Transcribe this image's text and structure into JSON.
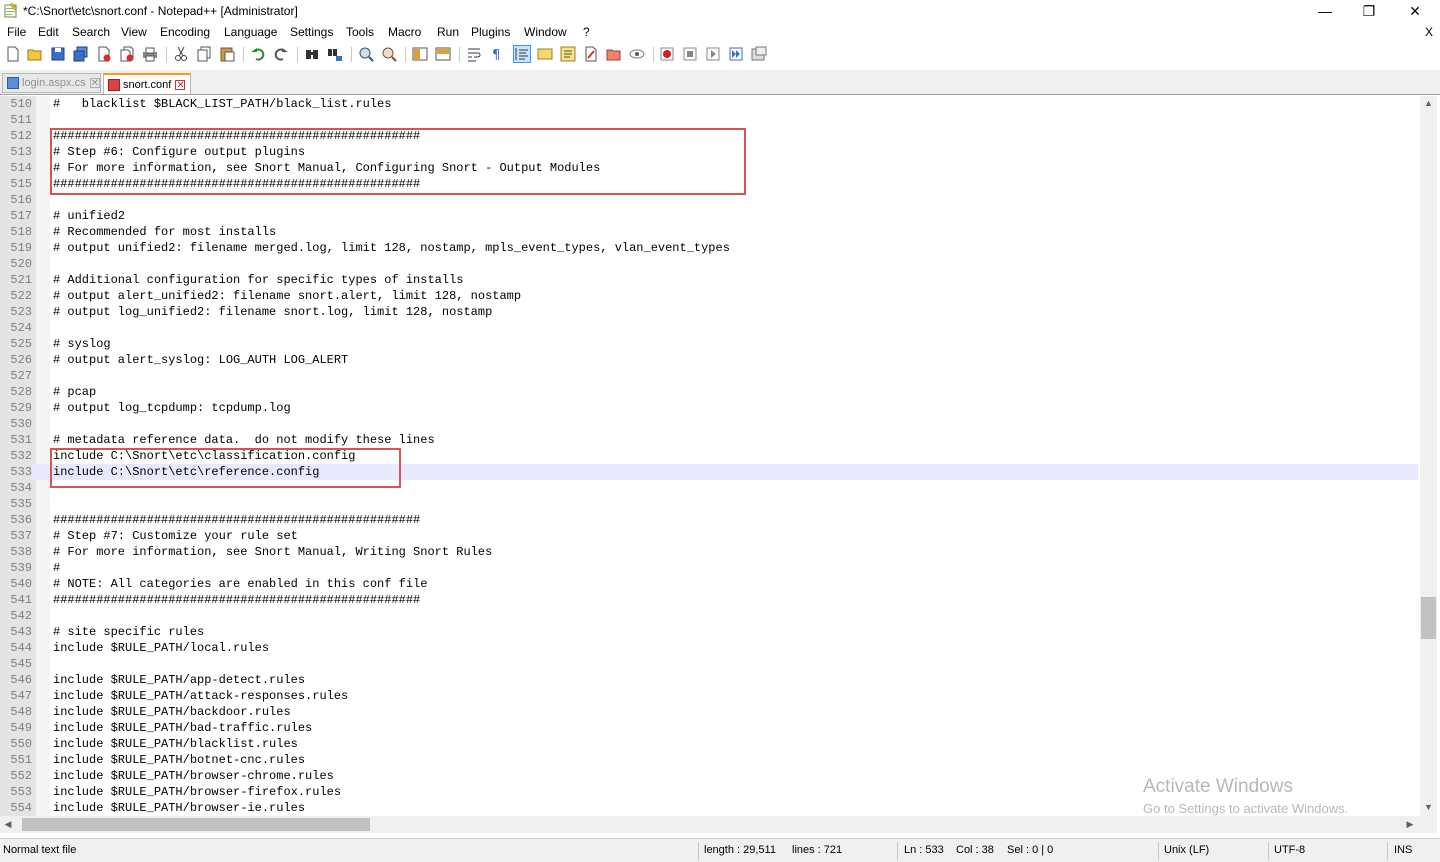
{
  "window": {
    "title": "*C:\\Snort\\etc\\snort.conf - Notepad++ [Administrator]",
    "minimize": "—",
    "restore": "❐",
    "close": "✕"
  },
  "menu": {
    "items": [
      "File",
      "Edit",
      "Search",
      "View",
      "Encoding",
      "Language",
      "Settings",
      "Tools",
      "Macro",
      "Run",
      "Plugins",
      "Window",
      "?"
    ],
    "close": "X"
  },
  "toolbar": {
    "icons": [
      "new-file-icon",
      "open-file-icon",
      "save-icon",
      "save-all-icon",
      "close-icon",
      "close-all-icon",
      "print-icon",
      "cut-icon",
      "copy-icon",
      "paste-icon",
      "undo-icon",
      "redo-icon",
      "find-icon",
      "replace-icon",
      "zoom-in-icon",
      "zoom-out-icon",
      "sync-vertical-icon",
      "sync-horizontal-icon",
      "word-wrap-icon",
      "show-all-chars-icon",
      "indent-guide-icon",
      "lang-icon",
      "function-list-icon",
      "document-map-icon",
      "folder-as-workspace-icon",
      "monitoring-icon",
      "record-macro-icon",
      "stop-record-icon",
      "play-macro-icon",
      "run-macro-multiple-icon",
      "save-macro-icon"
    ]
  },
  "tabs": [
    {
      "label": "login.aspx.cs",
      "close": "✕"
    },
    {
      "label": "snort.conf",
      "close": "✕"
    }
  ],
  "editor": {
    "current_line": 533,
    "lines": [
      {
        "n": "510",
        "t": "#   blacklist $BLACK_LIST_PATH/black_list.rules"
      },
      {
        "n": "511",
        "t": ""
      },
      {
        "n": "512",
        "t": "###################################################"
      },
      {
        "n": "513",
        "t": "# Step #6: Configure output plugins"
      },
      {
        "n": "514",
        "t": "# For more information, see Snort Manual, Configuring Snort - Output Modules"
      },
      {
        "n": "515",
        "t": "###################################################"
      },
      {
        "n": "516",
        "t": ""
      },
      {
        "n": "517",
        "t": "# unified2"
      },
      {
        "n": "518",
        "t": "# Recommended for most installs"
      },
      {
        "n": "519",
        "t": "# output unified2: filename merged.log, limit 128, nostamp, mpls_event_types, vlan_event_types"
      },
      {
        "n": "520",
        "t": ""
      },
      {
        "n": "521",
        "t": "# Additional configuration for specific types of installs"
      },
      {
        "n": "522",
        "t": "# output alert_unified2: filename snort.alert, limit 128, nostamp"
      },
      {
        "n": "523",
        "t": "# output log_unified2: filename snort.log, limit 128, nostamp"
      },
      {
        "n": "524",
        "t": ""
      },
      {
        "n": "525",
        "t": "# syslog"
      },
      {
        "n": "526",
        "t": "# output alert_syslog: LOG_AUTH LOG_ALERT"
      },
      {
        "n": "527",
        "t": ""
      },
      {
        "n": "528",
        "t": "# pcap"
      },
      {
        "n": "529",
        "t": "# output log_tcpdump: tcpdump.log"
      },
      {
        "n": "530",
        "t": ""
      },
      {
        "n": "531",
        "t": "# metadata reference data.  do not modify these lines"
      },
      {
        "n": "532",
        "t": "include C:\\Snort\\etc\\classification.config"
      },
      {
        "n": "533",
        "t": "include C:\\Snort\\etc\\reference.config"
      },
      {
        "n": "534",
        "t": ""
      },
      {
        "n": "535",
        "t": ""
      },
      {
        "n": "536",
        "t": "###################################################"
      },
      {
        "n": "537",
        "t": "# Step #7: Customize your rule set"
      },
      {
        "n": "538",
        "t": "# For more information, see Snort Manual, Writing Snort Rules"
      },
      {
        "n": "539",
        "t": "#"
      },
      {
        "n": "540",
        "t": "# NOTE: All categories are enabled in this conf file"
      },
      {
        "n": "541",
        "t": "###################################################"
      },
      {
        "n": "542",
        "t": ""
      },
      {
        "n": "543",
        "t": "# site specific rules"
      },
      {
        "n": "544",
        "t": "include $RULE_PATH/local.rules"
      },
      {
        "n": "545",
        "t": ""
      },
      {
        "n": "546",
        "t": "include $RULE_PATH/app-detect.rules"
      },
      {
        "n": "547",
        "t": "include $RULE_PATH/attack-responses.rules"
      },
      {
        "n": "548",
        "t": "include $RULE_PATH/backdoor.rules"
      },
      {
        "n": "549",
        "t": "include $RULE_PATH/bad-traffic.rules"
      },
      {
        "n": "550",
        "t": "include $RULE_PATH/blacklist.rules"
      },
      {
        "n": "551",
        "t": "include $RULE_PATH/botnet-cnc.rules"
      },
      {
        "n": "552",
        "t": "include $RULE_PATH/browser-chrome.rules"
      },
      {
        "n": "553",
        "t": "include $RULE_PATH/browser-firefox.rules"
      },
      {
        "n": "554",
        "t": "include $RULE_PATH/browser-ie.rules"
      }
    ]
  },
  "status": {
    "file_type": "Normal text file",
    "length": "length : 29,511",
    "lines": "lines : 721",
    "ln": "Ln : 533",
    "col": "Col : 38",
    "sel": "Sel : 0 | 0",
    "eol": "Unix (LF)",
    "encoding": "UTF-8",
    "mode": "INS"
  },
  "watermark": {
    "title": "Activate Windows",
    "subtitle": "Go to Settings to activate Windows."
  },
  "colors": {
    "highlight_box": "#d9534f",
    "current_line": "#e8e8ff",
    "tab_accent": "#fa9d18"
  }
}
